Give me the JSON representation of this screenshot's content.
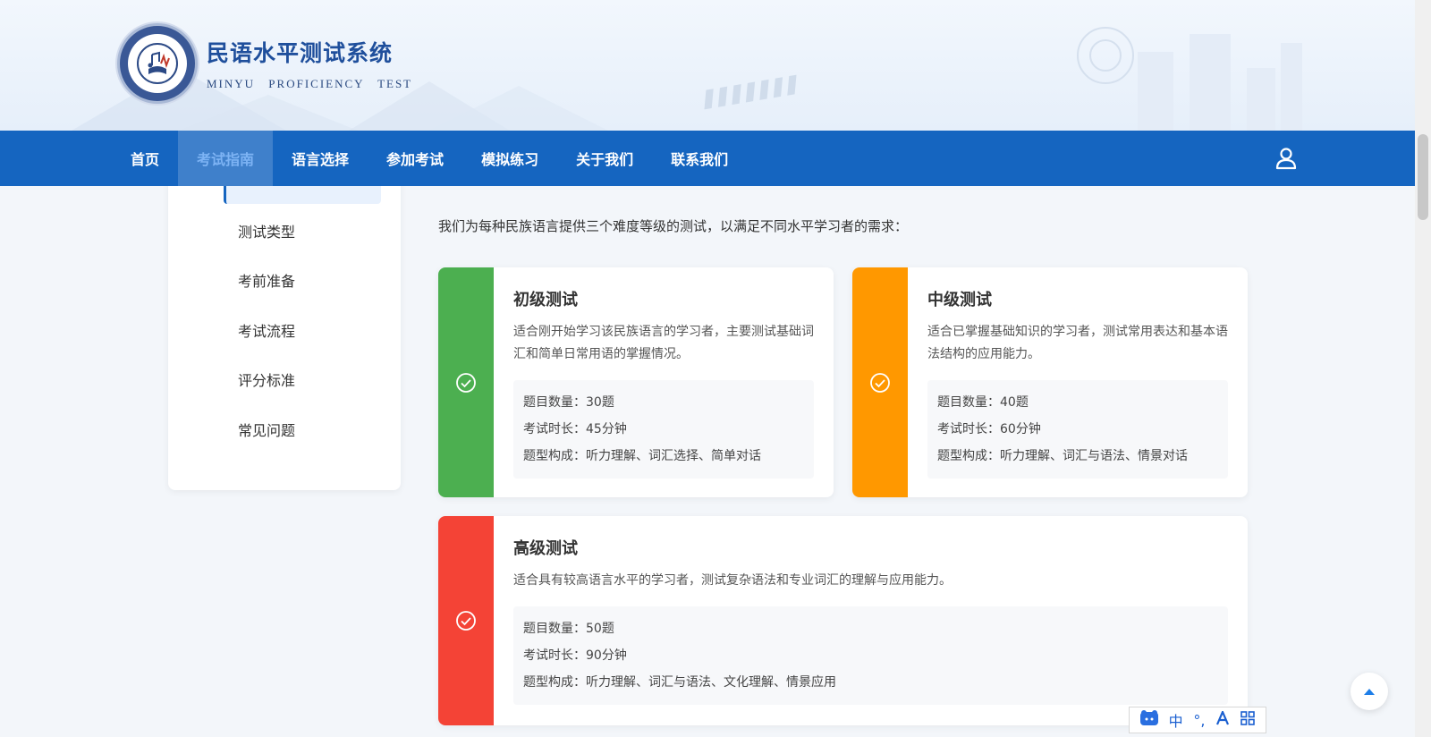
{
  "header": {
    "title_cn": "民语水平测试系统",
    "title_en": "MINYU PROFICIENCY TEST"
  },
  "nav": {
    "items": [
      {
        "label": "首页"
      },
      {
        "label": "考试指南"
      },
      {
        "label": "语言选择"
      },
      {
        "label": "参加考试"
      },
      {
        "label": "模拟练习"
      },
      {
        "label": "关于我们"
      },
      {
        "label": "联系我们"
      }
    ],
    "active_index": 1
  },
  "sidebar": {
    "items": [
      {
        "label": "测试类型"
      },
      {
        "label": "考前准备"
      },
      {
        "label": "考试流程"
      },
      {
        "label": "评分标准"
      },
      {
        "label": "常见问题"
      }
    ]
  },
  "main": {
    "intro": "我们为每种民族语言提供三个难度等级的测试，以满足不同水平学习者的需求：",
    "cards": [
      {
        "title": "初级测试",
        "desc": "适合刚开始学习该民族语言的学习者，主要测试基础词汇和简单日常用语的掌握情况。",
        "count": "题目数量：30题",
        "duration": "考试时长：45分钟",
        "types": "题型构成：听力理解、词汇选择、简单对话",
        "color": "#4caf50"
      },
      {
        "title": "中级测试",
        "desc": "适合已掌握基础知识的学习者，测试常用表达和基本语法结构的应用能力。",
        "count": "题目数量：40题",
        "duration": "考试时长：60分钟",
        "types": "题型构成：听力理解、词汇与语法、情景对话",
        "color": "#ff9800"
      },
      {
        "title": "高级测试",
        "desc": "适合具有较高语言水平的学习者，测试复杂语法和专业词汇的理解与应用能力。",
        "count": "题目数量：50题",
        "duration": "考试时长：90分钟",
        "types": "题型构成：听力理解、词汇与语法、文化理解、情景应用",
        "color": "#f44336"
      }
    ]
  },
  "ime": {
    "mode": "中",
    "punct": "°,"
  },
  "colors": {
    "primary": "#1565c0",
    "nav_active_text": "#7db3f4"
  }
}
